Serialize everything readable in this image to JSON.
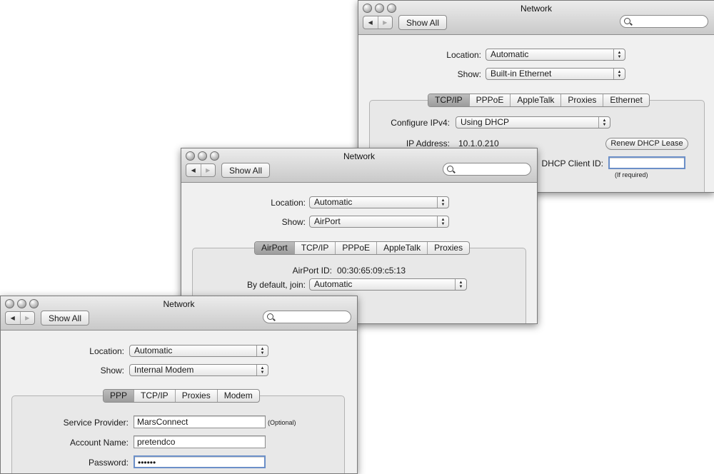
{
  "window_title": "Network",
  "show_all": "Show All",
  "nav": {
    "back": "◀",
    "forward": "▶"
  },
  "labels": {
    "location": "Location:",
    "show": "Show:",
    "configure_ipv4": "Configure IPv4:",
    "ip_address": "IP Address:",
    "dhcp_client_id": "DHCP Client ID:",
    "airport_id": "AirPort ID:",
    "by_default_join": "By default, join:",
    "service_provider": "Service Provider:",
    "account_name": "Account Name:",
    "password": "Password:"
  },
  "windows": {
    "ethernet": {
      "location": "Automatic",
      "show": "Built-in Ethernet",
      "tabs": [
        "TCP/IP",
        "PPPoE",
        "AppleTalk",
        "Proxies",
        "Ethernet"
      ],
      "active_tab": "TCP/IP",
      "configure_ipv4": "Using DHCP",
      "ip_address": "10.1.0.210",
      "renew_button": "Renew DHCP Lease",
      "dhcp_client_id": "",
      "if_required": "(If required)"
    },
    "airport": {
      "location": "Automatic",
      "show": "AirPort",
      "tabs": [
        "AirPort",
        "TCP/IP",
        "PPPoE",
        "AppleTalk",
        "Proxies"
      ],
      "active_tab": "AirPort",
      "airport_id": "00:30:65:09:c5:13",
      "join": "Automatic"
    },
    "modem": {
      "location": "Automatic",
      "show": "Internal Modem",
      "tabs": [
        "PPP",
        "TCP/IP",
        "Proxies",
        "Modem"
      ],
      "active_tab": "PPP",
      "service_provider": "MarsConnect",
      "optional": "(Optional)",
      "account_name": "pretendco",
      "password": "••••••"
    }
  }
}
